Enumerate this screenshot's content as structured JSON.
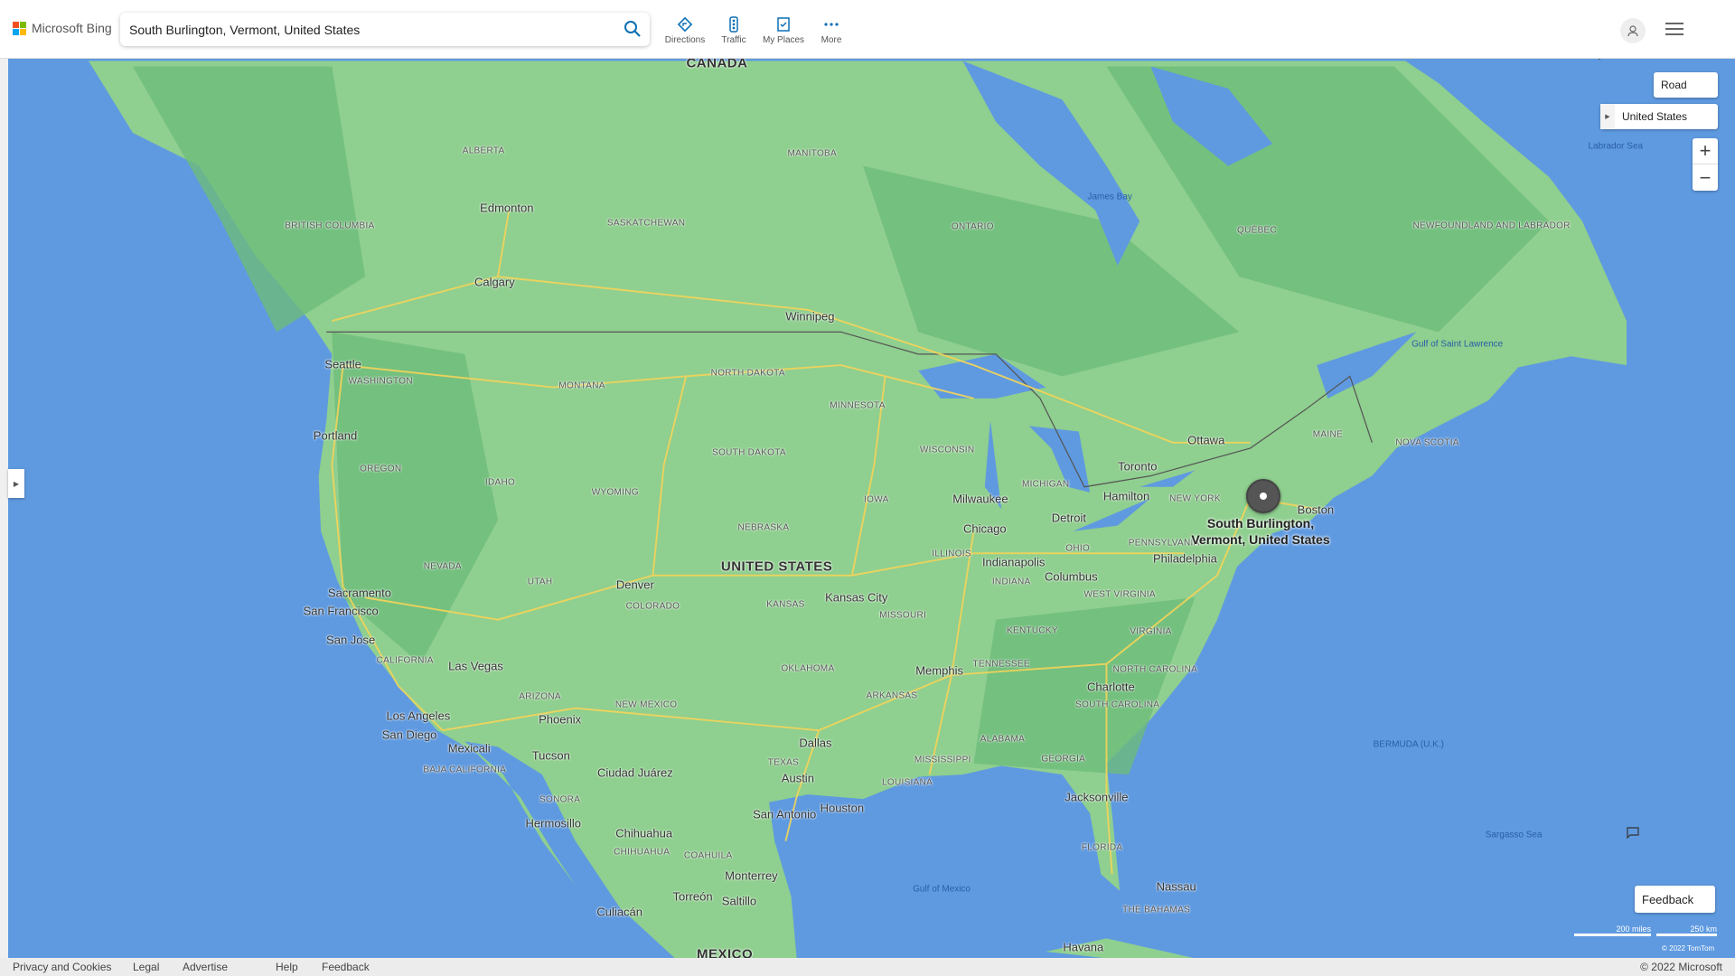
{
  "header": {
    "brand": "Microsoft Bing",
    "search_value": "South Burlington, Vermont, United States",
    "nav": [
      {
        "label": "Directions",
        "icon": "directions-icon"
      },
      {
        "label": "Traffic",
        "icon": "traffic-icon"
      },
      {
        "label": "My Places",
        "icon": "my-places-icon"
      },
      {
        "label": "More",
        "icon": "more-icon"
      }
    ]
  },
  "map_controls": {
    "style": "Road",
    "region": "United States",
    "feedback": "Feedback",
    "scale_miles": "200 miles",
    "scale_km": "250 km",
    "attribution": "© 2022 TomTom"
  },
  "pin": {
    "line1": "South Burlington,",
    "line2": "Vermont, United States"
  },
  "map_labels": [
    {
      "t": "CANADA",
      "k": "country"
    },
    {
      "t": "UNITED STATES",
      "k": "country"
    },
    {
      "t": "MEXICO",
      "k": "country"
    },
    {
      "t": "ALBERTA",
      "k": "state"
    },
    {
      "t": "BRITISH COLUMBIA",
      "k": "state"
    },
    {
      "t": "SASKATCHEWAN",
      "k": "state"
    },
    {
      "t": "MANITOBA",
      "k": "state"
    },
    {
      "t": "ONTARIO",
      "k": "state"
    },
    {
      "t": "QUÉBEC",
      "k": "state"
    },
    {
      "t": "NEWFOUNDLAND AND LABRADOR",
      "k": "state"
    },
    {
      "t": "WASHINGTON",
      "k": "state"
    },
    {
      "t": "OREGON",
      "k": "state"
    },
    {
      "t": "CALIFORNIA",
      "k": "state"
    },
    {
      "t": "NEVADA",
      "k": "state"
    },
    {
      "t": "IDAHO",
      "k": "state"
    },
    {
      "t": "MONTANA",
      "k": "state"
    },
    {
      "t": "WYOMING",
      "k": "state"
    },
    {
      "t": "UTAH",
      "k": "state"
    },
    {
      "t": "ARIZONA",
      "k": "state"
    },
    {
      "t": "COLORADO",
      "k": "state"
    },
    {
      "t": "NEW MEXICO",
      "k": "state"
    },
    {
      "t": "NORTH DAKOTA",
      "k": "state"
    },
    {
      "t": "SOUTH DAKOTA",
      "k": "state"
    },
    {
      "t": "NEBRASKA",
      "k": "state"
    },
    {
      "t": "KANSAS",
      "k": "state"
    },
    {
      "t": "OKLAHOMA",
      "k": "state"
    },
    {
      "t": "TEXAS",
      "k": "state"
    },
    {
      "t": "MINNESOTA",
      "k": "state"
    },
    {
      "t": "IOWA",
      "k": "state"
    },
    {
      "t": "MISSOURI",
      "k": "state"
    },
    {
      "t": "ARKANSAS",
      "k": "state"
    },
    {
      "t": "LOUISIANA",
      "k": "state"
    },
    {
      "t": "WISCONSIN",
      "k": "state"
    },
    {
      "t": "ILLINOIS",
      "k": "state"
    },
    {
      "t": "MICHIGAN",
      "k": "state"
    },
    {
      "t": "INDIANA",
      "k": "state"
    },
    {
      "t": "OHIO",
      "k": "state"
    },
    {
      "t": "KENTUCKY",
      "k": "state"
    },
    {
      "t": "TENNESSEE",
      "k": "state"
    },
    {
      "t": "MISSISSIPPI",
      "k": "state"
    },
    {
      "t": "ALABAMA",
      "k": "state"
    },
    {
      "t": "GEORGIA",
      "k": "state"
    },
    {
      "t": "FLORIDA",
      "k": "state"
    },
    {
      "t": "SOUTH CAROLINA",
      "k": "state"
    },
    {
      "t": "NORTH CAROLINA",
      "k": "state"
    },
    {
      "t": "VIRGINIA",
      "k": "state"
    },
    {
      "t": "WEST VIRGINIA",
      "k": "state"
    },
    {
      "t": "PENNSYLVANIA",
      "k": "state"
    },
    {
      "t": "NEW YORK",
      "k": "state"
    },
    {
      "t": "MAINE",
      "k": "state"
    },
    {
      "t": "NOVA SCOTIA",
      "k": "state"
    },
    {
      "t": "SONORA",
      "k": "state"
    },
    {
      "t": "CHIHUAHUA",
      "k": "state"
    },
    {
      "t": "COAHUILA",
      "k": "state"
    },
    {
      "t": "BAJA CALIFORNIA",
      "k": "state"
    },
    {
      "t": "THE BAHAMAS",
      "k": "state"
    },
    {
      "t": "Edmonton",
      "k": "city"
    },
    {
      "t": "Calgary",
      "k": "city"
    },
    {
      "t": "Winnipeg",
      "k": "city"
    },
    {
      "t": "Seattle",
      "k": "city"
    },
    {
      "t": "Portland",
      "k": "city"
    },
    {
      "t": "Sacramento",
      "k": "city"
    },
    {
      "t": "San Francisco",
      "k": "city"
    },
    {
      "t": "San Jose",
      "k": "city"
    },
    {
      "t": "Las Vegas",
      "k": "city"
    },
    {
      "t": "Los Angeles",
      "k": "city"
    },
    {
      "t": "San Diego",
      "k": "city"
    },
    {
      "t": "Mexicali",
      "k": "city"
    },
    {
      "t": "Phoenix",
      "k": "city"
    },
    {
      "t": "Tucson",
      "k": "city"
    },
    {
      "t": "Denver",
      "k": "city"
    },
    {
      "t": "Ciudad Juárez",
      "k": "city"
    },
    {
      "t": "Hermosillo",
      "k": "city"
    },
    {
      "t": "Chihuahua",
      "k": "city"
    },
    {
      "t": "Monterrey",
      "k": "city"
    },
    {
      "t": "Saltillo",
      "k": "city"
    },
    {
      "t": "Torreón",
      "k": "city"
    },
    {
      "t": "Culiacán",
      "k": "city"
    },
    {
      "t": "Dallas",
      "k": "city"
    },
    {
      "t": "Austin",
      "k": "city"
    },
    {
      "t": "San Antonio",
      "k": "city"
    },
    {
      "t": "Houston",
      "k": "city"
    },
    {
      "t": "Kansas City",
      "k": "city"
    },
    {
      "t": "Memphis",
      "k": "city"
    },
    {
      "t": "Chicago",
      "k": "city"
    },
    {
      "t": "Milwaukee",
      "k": "city"
    },
    {
      "t": "Indianapolis",
      "k": "city"
    },
    {
      "t": "Columbus",
      "k": "city"
    },
    {
      "t": "Detroit",
      "k": "city"
    },
    {
      "t": "Toronto",
      "k": "city"
    },
    {
      "t": "Hamilton",
      "k": "city"
    },
    {
      "t": "Ottawa",
      "k": "city"
    },
    {
      "t": "Boston",
      "k": "city"
    },
    {
      "t": "Philadelphia",
      "k": "city"
    },
    {
      "t": "Charlotte",
      "k": "city"
    },
    {
      "t": "Jacksonville",
      "k": "city"
    },
    {
      "t": "Havana",
      "k": "city"
    },
    {
      "t": "Nassau",
      "k": "city"
    },
    {
      "t": "James Bay",
      "k": "sea"
    },
    {
      "t": "Labrador Sea",
      "k": "sea"
    },
    {
      "t": "Gulf of Saint Lawrence",
      "k": "sea"
    },
    {
      "t": "Gulf of Mexico",
      "k": "sea"
    },
    {
      "t": "Sargasso Sea",
      "k": "sea"
    },
    {
      "t": "BERMUDA (U.K.)",
      "k": "sea"
    }
  ],
  "footer": {
    "links": [
      "Privacy and Cookies",
      "Legal",
      "Advertise",
      "Help",
      "Feedback"
    ],
    "copyright": "© 2022 Microsoft"
  },
  "colors": {
    "water": "#5f9ae0",
    "land": "#8fcf8f",
    "forest": "#6dbb7a",
    "road": "#f3d45a",
    "pin": "#555555"
  }
}
